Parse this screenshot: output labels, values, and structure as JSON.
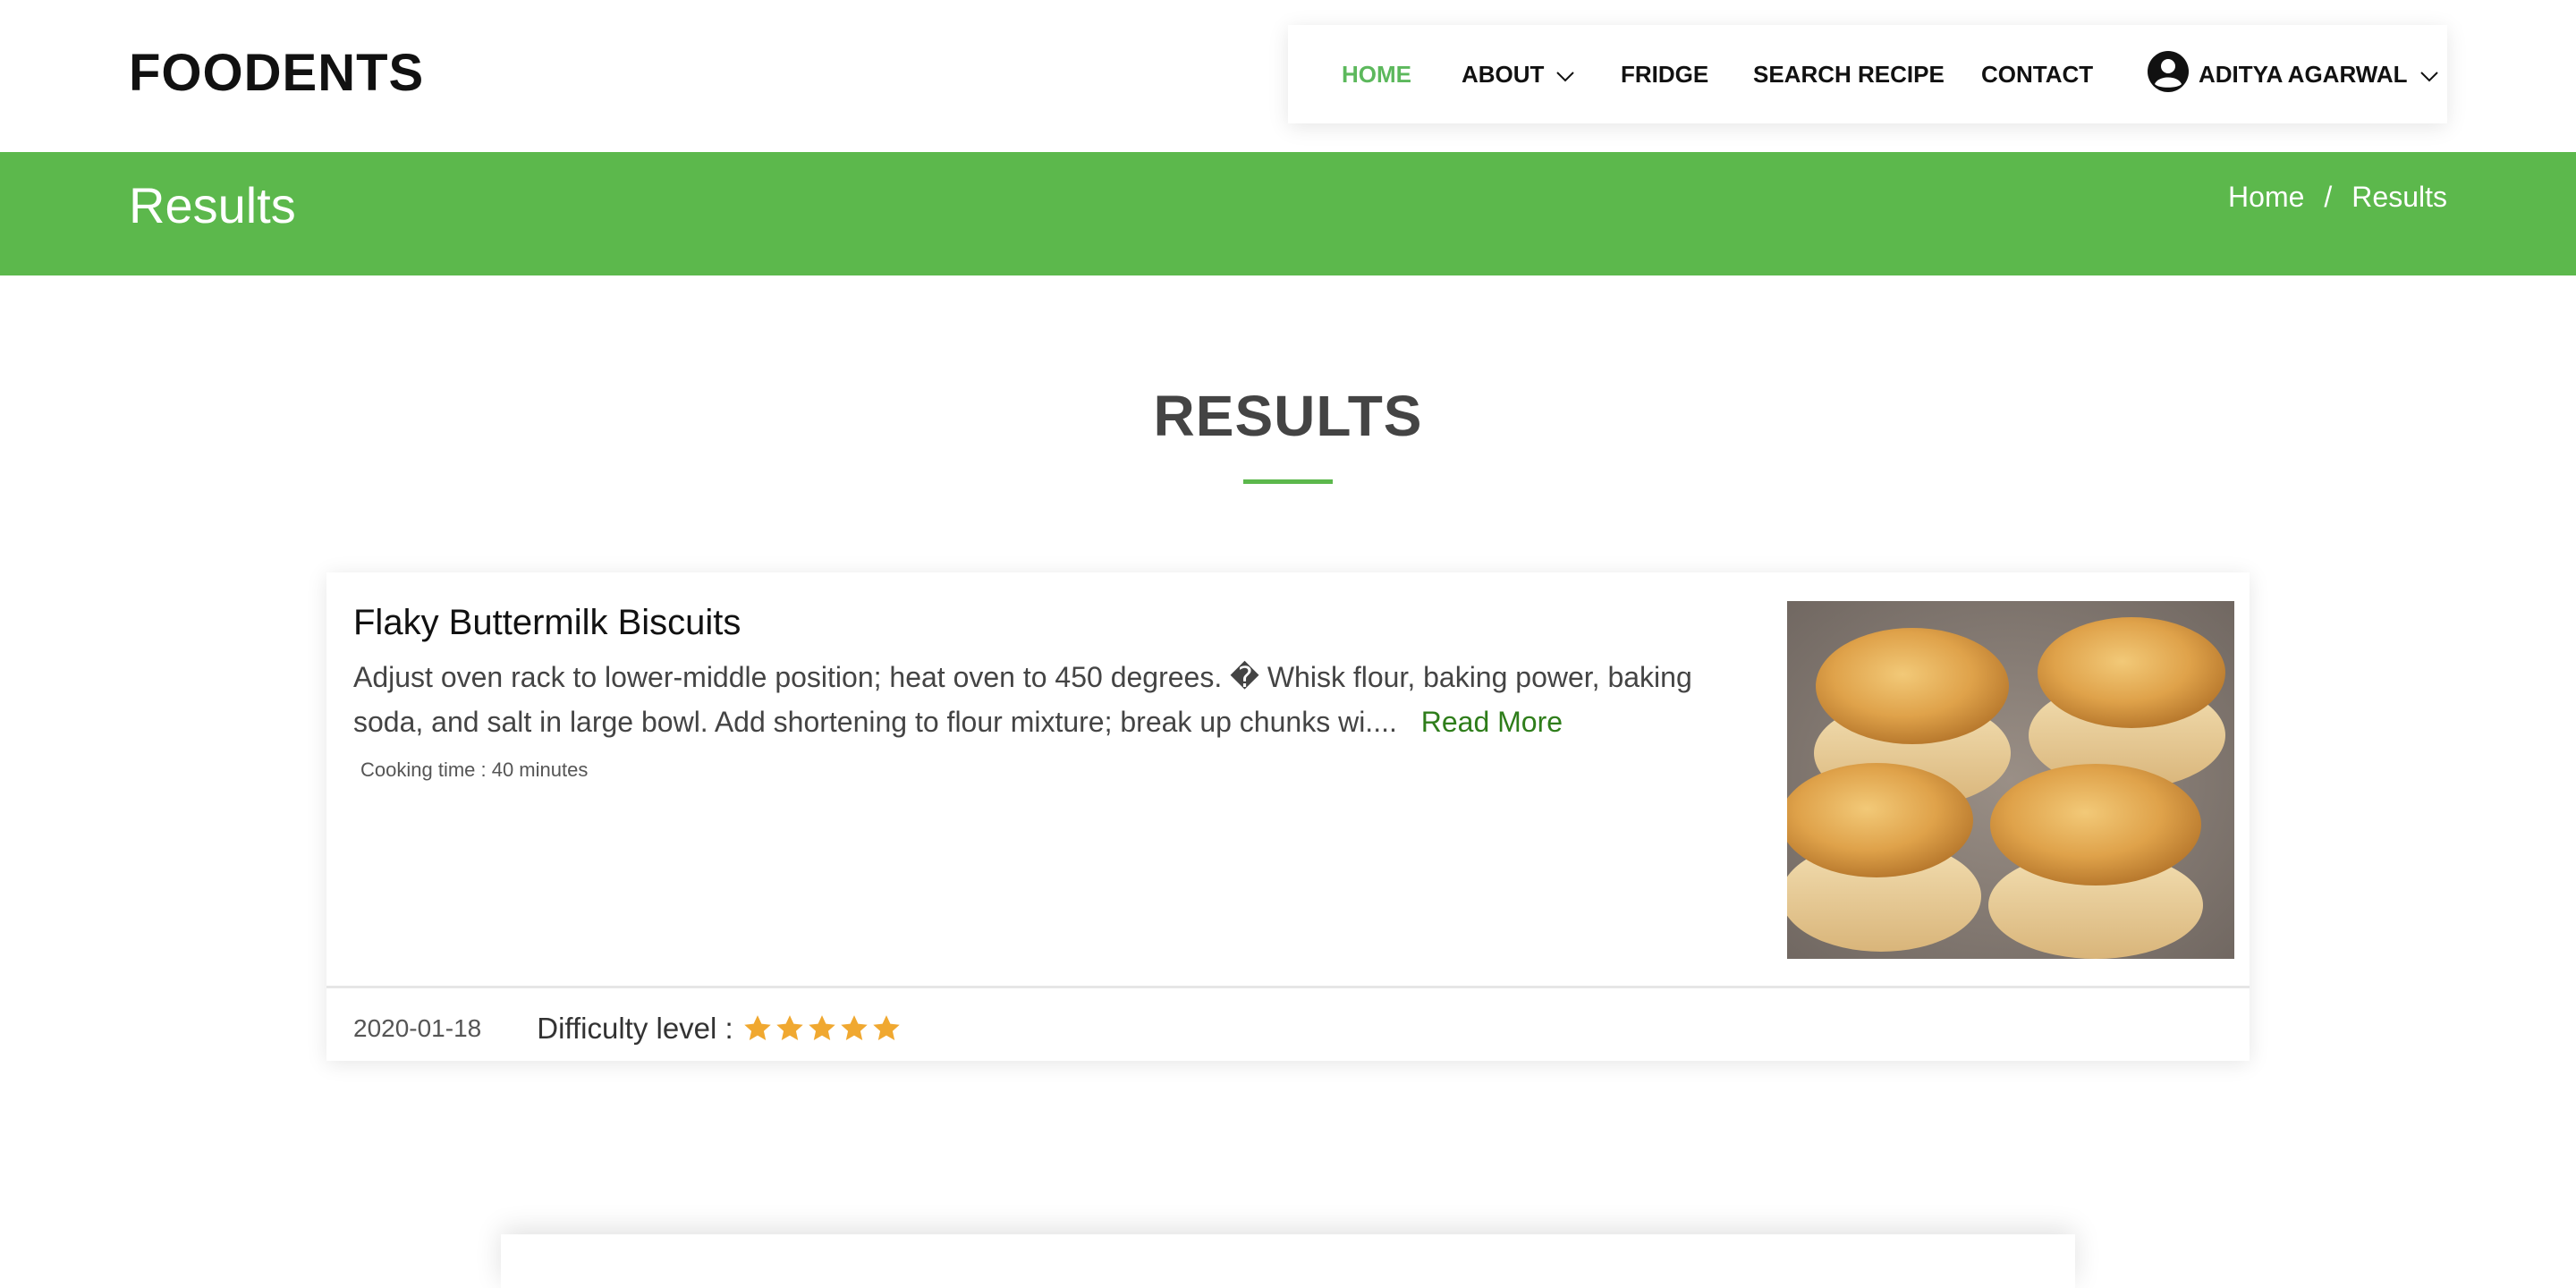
{
  "site": {
    "logo": "FOODENTS"
  },
  "nav": {
    "home": "HOME",
    "about": "ABOUT",
    "fridge": "FRIDGE",
    "search_recipe": "SEARCH RECIPE",
    "contact": "CONTACT",
    "user": "ADITYA AGARWAL",
    "active_color": "#5cb85c"
  },
  "banner": {
    "title": "Results",
    "breadcrumb": {
      "home": "Home",
      "separator": "/",
      "current": "Results"
    },
    "color": "#5cb84c"
  },
  "section": {
    "title": "RESULTS"
  },
  "recipes": [
    {
      "title": "Flaky Buttermilk Biscuits",
      "description": "Adjust oven rack to lower-middle position; heat oven to 450 degrees. � Whisk flour, baking power, baking soda, and salt in large bowl. Add shortening to flour mixture; break up chunks wi....",
      "read_more": "Read More",
      "cooking_time": "Cooking time : 40 minutes",
      "date": "2020-01-18",
      "difficulty_label": "Difficulty level :",
      "difficulty_stars": 5,
      "image_icon": "biscuits-photo"
    }
  ],
  "icons": {
    "user": "user-circle-icon",
    "chevron": "chevron-down-icon",
    "star": "star-icon"
  },
  "colors": {
    "star": "#f0a830",
    "read_more": "#2e7d1a"
  }
}
